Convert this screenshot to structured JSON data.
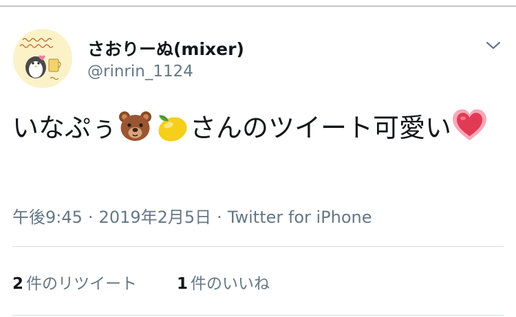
{
  "tweet": {
    "author": {
      "display_name": "さおりーぬ(mixer)",
      "handle": "@rinrin_1124",
      "avatar_icon": "penguin-avatar"
    },
    "menu_icon": "chevron-down-icon",
    "text_parts": [
      "いなぷぅ",
      "さんのツイート可愛い"
    ],
    "emojis": [
      "bear-face-emoji",
      "lemon-emoji",
      "glowing-heart-emoji"
    ],
    "meta": {
      "time": "午後9:45",
      "separator": "·",
      "date": "2019年2月5日",
      "source": "Twitter for iPhone"
    },
    "stats": {
      "retweets_count": "2",
      "retweets_label": "件のリツイート",
      "likes_count": "1",
      "likes_label": "件のいいね"
    },
    "colors": {
      "text_primary": "#14171a",
      "text_secondary": "#657786",
      "divider": "#d5dbe0",
      "avatar_background": "#fbf2c8"
    }
  }
}
